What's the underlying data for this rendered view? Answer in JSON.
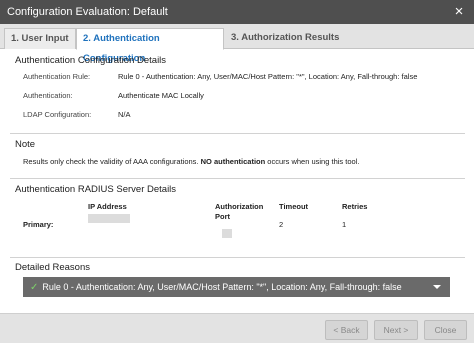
{
  "window": {
    "title": "Configuration Evaluation: Default"
  },
  "tabs": [
    {
      "label": "1. User Input"
    },
    {
      "label": "2. Authentication Configuration"
    },
    {
      "label": "3. Authorization Results"
    }
  ],
  "auth_details": {
    "title": "Authentication Configuration Details",
    "rows": [
      {
        "label": "Authentication Rule:",
        "value": "Rule 0 - Authentication: Any, User/MAC/Host Pattern: \"*\", Location: Any, Fall-through: false"
      },
      {
        "label": "Authentication:",
        "value": "Authenticate MAC Locally"
      },
      {
        "label": "LDAP Configuration:",
        "value": "N/A"
      }
    ]
  },
  "note": {
    "title": "Note",
    "text_before": "Results only check the validity of AAA configurations. ",
    "text_bold": "NO authentication",
    "text_after": " occurs when using this tool."
  },
  "radius": {
    "title": "Authentication RADIUS Server Details",
    "headers": {
      "ip": "IP Address",
      "authz_port_line1": "Authorization",
      "authz_port_line2": "Port",
      "timeout": "Timeout",
      "retries": "Retries"
    },
    "primary": {
      "label": "Primary:",
      "timeout": "2",
      "retries": "1"
    }
  },
  "reasons": {
    "title": "Detailed Reasons",
    "item": "Rule 0 - Authentication: Any, User/MAC/Host Pattern: \"*\", Location: Any, Fall-through: false"
  },
  "footer": {
    "back": "< Back",
    "next": "Next >",
    "close": "Close"
  },
  "colors": {
    "titlebar": "#4f4f4f",
    "active_tab": "#1f72bd",
    "reason_bar": "#6a6a6a",
    "check": "#7ed36a"
  }
}
